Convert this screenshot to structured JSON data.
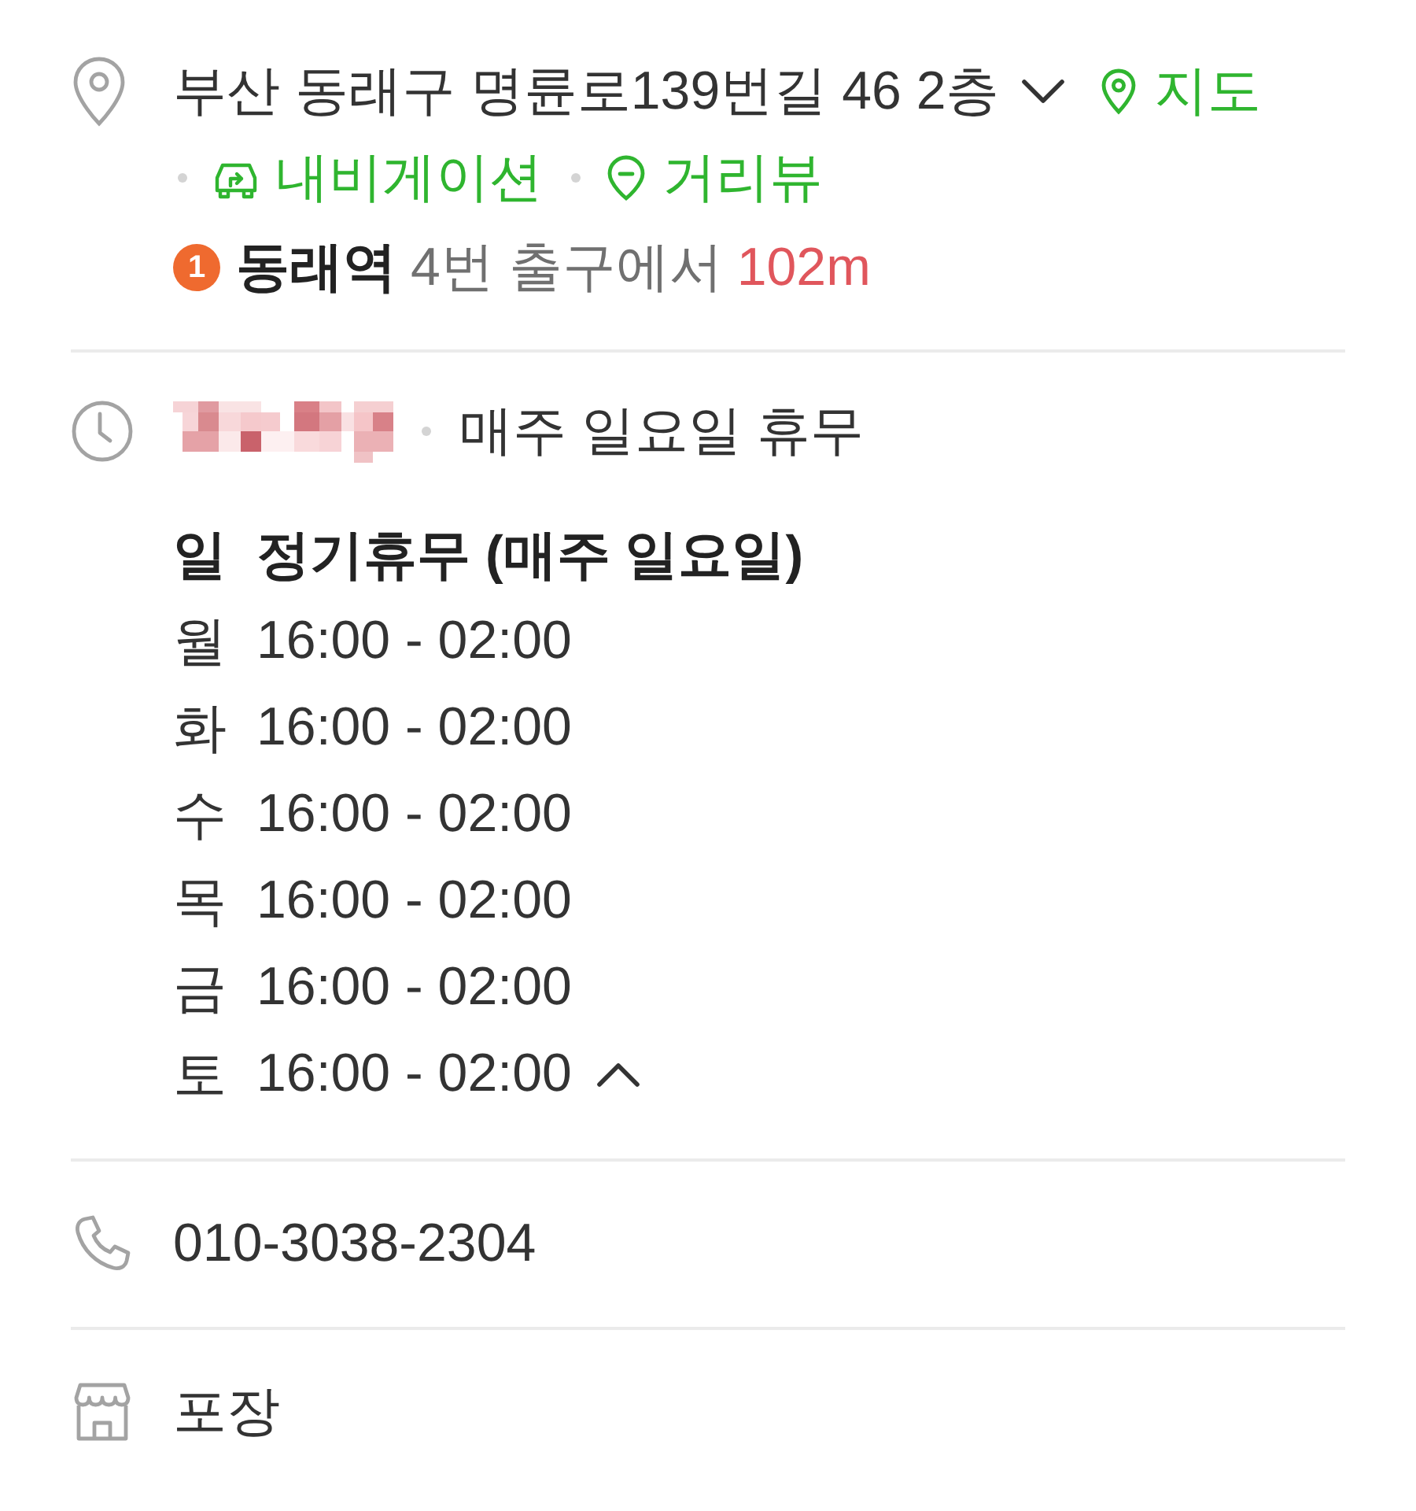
{
  "address": {
    "text": "부산 동래구 명륜로139번길 46 2층",
    "expanded": false,
    "links": [
      {
        "kind": "map",
        "label": "지도"
      },
      {
        "kind": "navigation",
        "label": "내비게이션"
      },
      {
        "kind": "street_view",
        "label": "거리뷰"
      }
    ]
  },
  "transit": {
    "line": "1",
    "station": "동래역",
    "exit": "4번 출구에서",
    "distance": "102m"
  },
  "hours": {
    "note": "매주 일요일 휴무",
    "expanded": true,
    "days": [
      {
        "day": "일",
        "time": "정기휴무 (매주 일요일)",
        "closed": true
      },
      {
        "day": "월",
        "time": "16:00 - 02:00",
        "closed": false
      },
      {
        "day": "화",
        "time": "16:00 - 02:00",
        "closed": false
      },
      {
        "day": "수",
        "time": "16:00 - 02:00",
        "closed": false
      },
      {
        "day": "목",
        "time": "16:00 - 02:00",
        "closed": false
      },
      {
        "day": "금",
        "time": "16:00 - 02:00",
        "closed": false
      },
      {
        "day": "토",
        "time": "16:00 - 02:00",
        "closed": false
      }
    ]
  },
  "phone": {
    "number": "010-3038-2304"
  },
  "services": {
    "text": "포장"
  }
}
